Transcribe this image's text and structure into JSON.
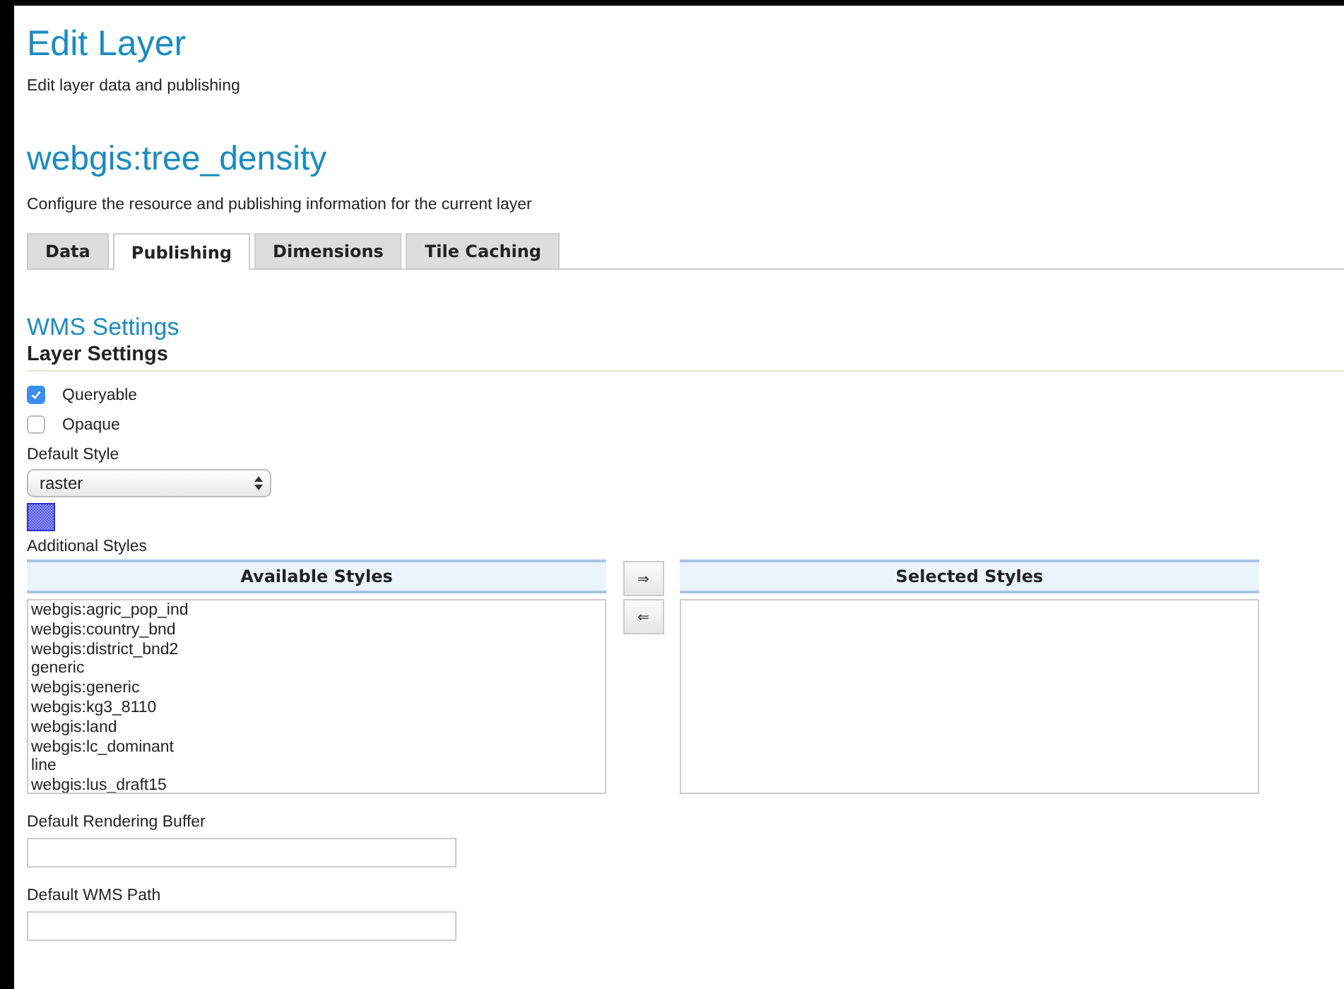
{
  "page": {
    "title": "Edit Layer",
    "subtitle": "Edit layer data and publishing"
  },
  "layer": {
    "name": "webgis:tree_density",
    "description": "Configure the resource and publishing information for the current layer"
  },
  "tabs": [
    {
      "label": "Data",
      "selected": false
    },
    {
      "label": "Publishing",
      "selected": true
    },
    {
      "label": "Dimensions",
      "selected": false
    },
    {
      "label": "Tile Caching",
      "selected": false
    }
  ],
  "section": {
    "title": "WMS Settings",
    "subtitle": "Layer Settings"
  },
  "options": [
    {
      "label": "Queryable",
      "checked": true
    },
    {
      "label": "Opaque",
      "checked": false
    }
  ],
  "default_style": {
    "label": "Default Style",
    "value": "raster"
  },
  "additional_styles": {
    "label": "Additional Styles",
    "available_title": "Available Styles",
    "selected_title": "Selected Styles",
    "available": [
      "webgis:agric_pop_ind",
      "webgis:country_bnd",
      "webgis:district_bnd2",
      "generic",
      "webgis:generic",
      "webgis:kg3_8110",
      "webgis:land",
      "webgis:lc_dominant",
      "line",
      "webgis:lus_draft15"
    ],
    "add_button": "⇒",
    "remove_button": "⇐"
  },
  "fields": [
    {
      "label": "Default Rendering Buffer"
    },
    {
      "label": "Default WMS Path"
    }
  ]
}
